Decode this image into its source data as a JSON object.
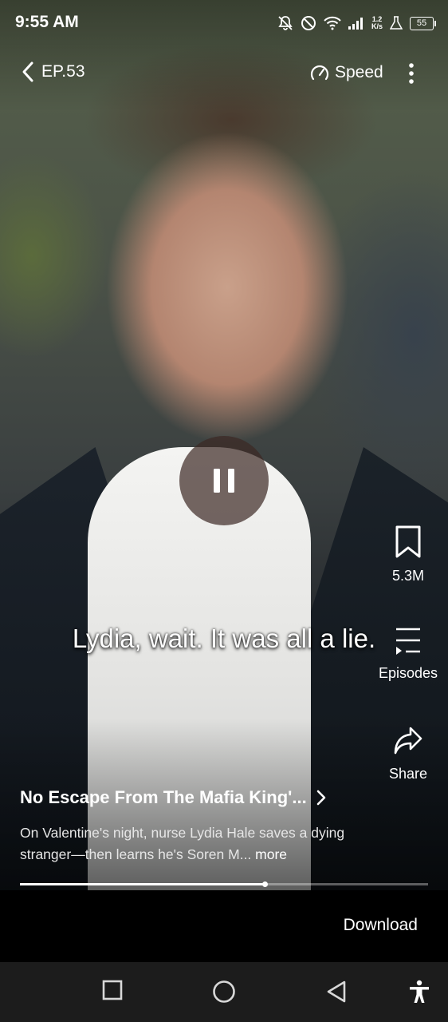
{
  "status": {
    "time": "9:55 AM",
    "net_speed_value": "1.2",
    "net_speed_unit": "K/s",
    "battery": "55",
    "icons": [
      "mute-bell-icon",
      "do-not-disturb-icon",
      "wifi-icon",
      "signal-icon",
      "net-speed",
      "lab-icon",
      "battery-icon"
    ]
  },
  "topnav": {
    "episode": "EP.53",
    "speed_label": "Speed"
  },
  "player": {
    "state": "playing",
    "subtitle": "Lydia, wait. It was all a lie.",
    "progress": 0.6
  },
  "rail": {
    "bookmark_count": "5.3M",
    "episodes_label": "Episodes",
    "share_label": "Share"
  },
  "show": {
    "title": "No Escape From The Mafia King'...",
    "description": "On Valentine's night, nurse Lydia Hale saves a dying stranger—then learns he's Soren M...",
    "more_label": "more"
  },
  "footer": {
    "download_label": "Download"
  },
  "colors": {
    "background": "#000000",
    "text": "#ffffff",
    "navbar": "#1c1c1c"
  }
}
